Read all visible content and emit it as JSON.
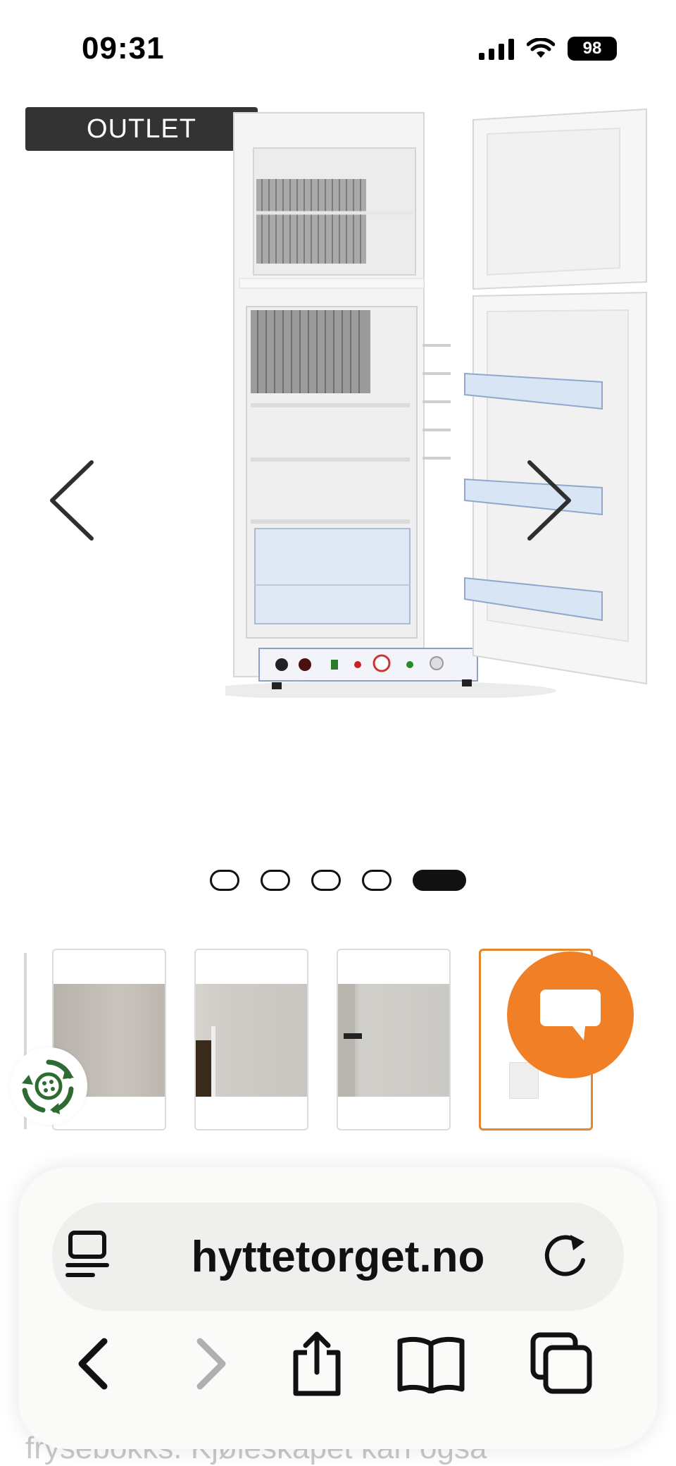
{
  "status_bar": {
    "time": "09:31",
    "battery": "98"
  },
  "product": {
    "badge": "OUTLET"
  },
  "gallery": {
    "total_slides": 5,
    "active_slide": 5,
    "thumbnail_count": 4,
    "selected_thumbnail": 4
  },
  "browser": {
    "url": "hyttetorget.no"
  },
  "background_text": "frysebokks. Kjøleskapet kan også",
  "icons": {
    "prev": "chevron-left-icon",
    "next": "chevron-right-icon",
    "chat": "chat-bubble-icon",
    "recycle": "recycle-icon",
    "page_menu": "page-menu-icon",
    "reload": "reload-icon",
    "back": "back-icon",
    "forward": "forward-icon",
    "share": "share-icon",
    "bookmarks": "bookmarks-icon",
    "tabs": "tabs-icon"
  },
  "colors": {
    "accent": "#f07f25",
    "badge_bg": "#333333",
    "recycle_green": "#2e6b32"
  }
}
